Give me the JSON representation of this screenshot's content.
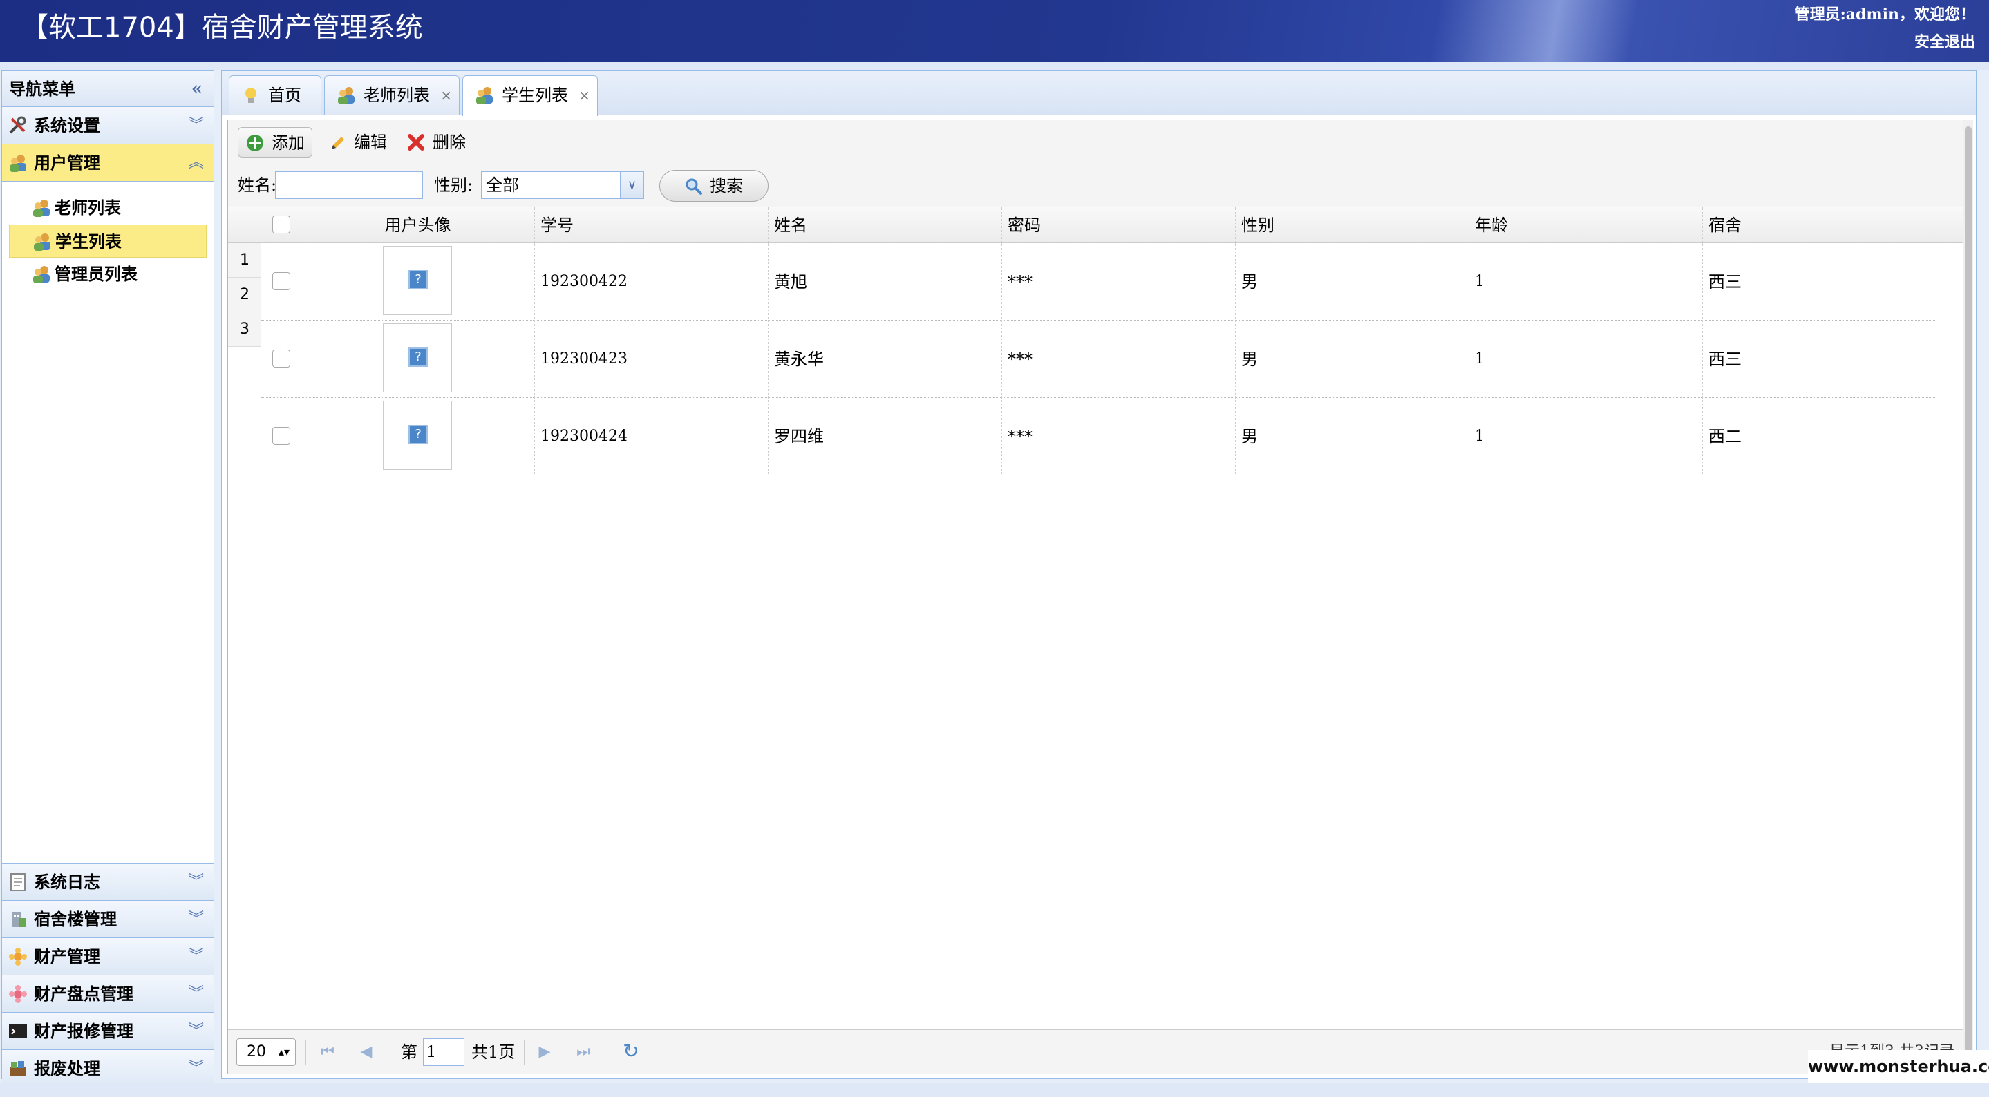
{
  "header": {
    "title": "【软工1704】宿舍财产管理系统",
    "welcome": "管理员:admin，欢迎您！",
    "logout": "安全退出"
  },
  "sidebar": {
    "title": "导航菜单",
    "sections": [
      {
        "label": "系统设置",
        "icon": "tools-icon"
      },
      {
        "label": "用户管理",
        "icon": "users-icon",
        "active": true
      },
      {
        "label": "系统日志",
        "icon": "log-icon"
      },
      {
        "label": "宿舍楼管理",
        "icon": "building-icon"
      },
      {
        "label": "财产管理",
        "icon": "asset-icon"
      },
      {
        "label": "财产盘点管理",
        "icon": "inventory-icon"
      },
      {
        "label": "财产报修管理",
        "icon": "terminal-icon"
      },
      {
        "label": "报废处理",
        "icon": "scrap-icon"
      }
    ],
    "user_items": [
      {
        "label": "老师列表"
      },
      {
        "label": "学生列表",
        "selected": true
      },
      {
        "label": "管理员列表"
      }
    ]
  },
  "tabs": [
    {
      "label": "首页"
    },
    {
      "label": "老师列表",
      "close": "×"
    },
    {
      "label": "学生列表",
      "close": "×",
      "active": true
    }
  ],
  "toolbar": {
    "add": "添加",
    "edit": "编辑",
    "delete": "删除"
  },
  "search": {
    "name_label": "姓名:",
    "name_value": "",
    "gender_label": "性别:",
    "gender_selected": "全部",
    "search_button": "搜索"
  },
  "grid": {
    "columns": [
      "用户头像",
      "学号",
      "姓名",
      "密码",
      "性别",
      "年龄",
      "宿舍"
    ],
    "row_numbers": [
      "1",
      "2",
      "3"
    ],
    "rows": [
      {
        "id": "192300422",
        "name": "黄旭",
        "password": "***",
        "gender": "男",
        "age": "1",
        "dorm": "西三"
      },
      {
        "id": "192300423",
        "name": "黄永华",
        "password": "***",
        "gender": "男",
        "age": "1",
        "dorm": "西三"
      },
      {
        "id": "192300424",
        "name": "罗四维",
        "password": "***",
        "gender": "男",
        "age": "1",
        "dorm": "西二"
      }
    ],
    "avatar_placeholder": "?"
  },
  "pager": {
    "page_size": "20",
    "page_prefix": "第",
    "page_value": "1",
    "page_total": "共1页",
    "info": "显示1到3,共3记录"
  },
  "watermark": "www.monsterhua.com",
  "colors": {
    "header_bg": "#22378f",
    "selected_bg": "#fbec88",
    "border": "#99bbe8"
  }
}
